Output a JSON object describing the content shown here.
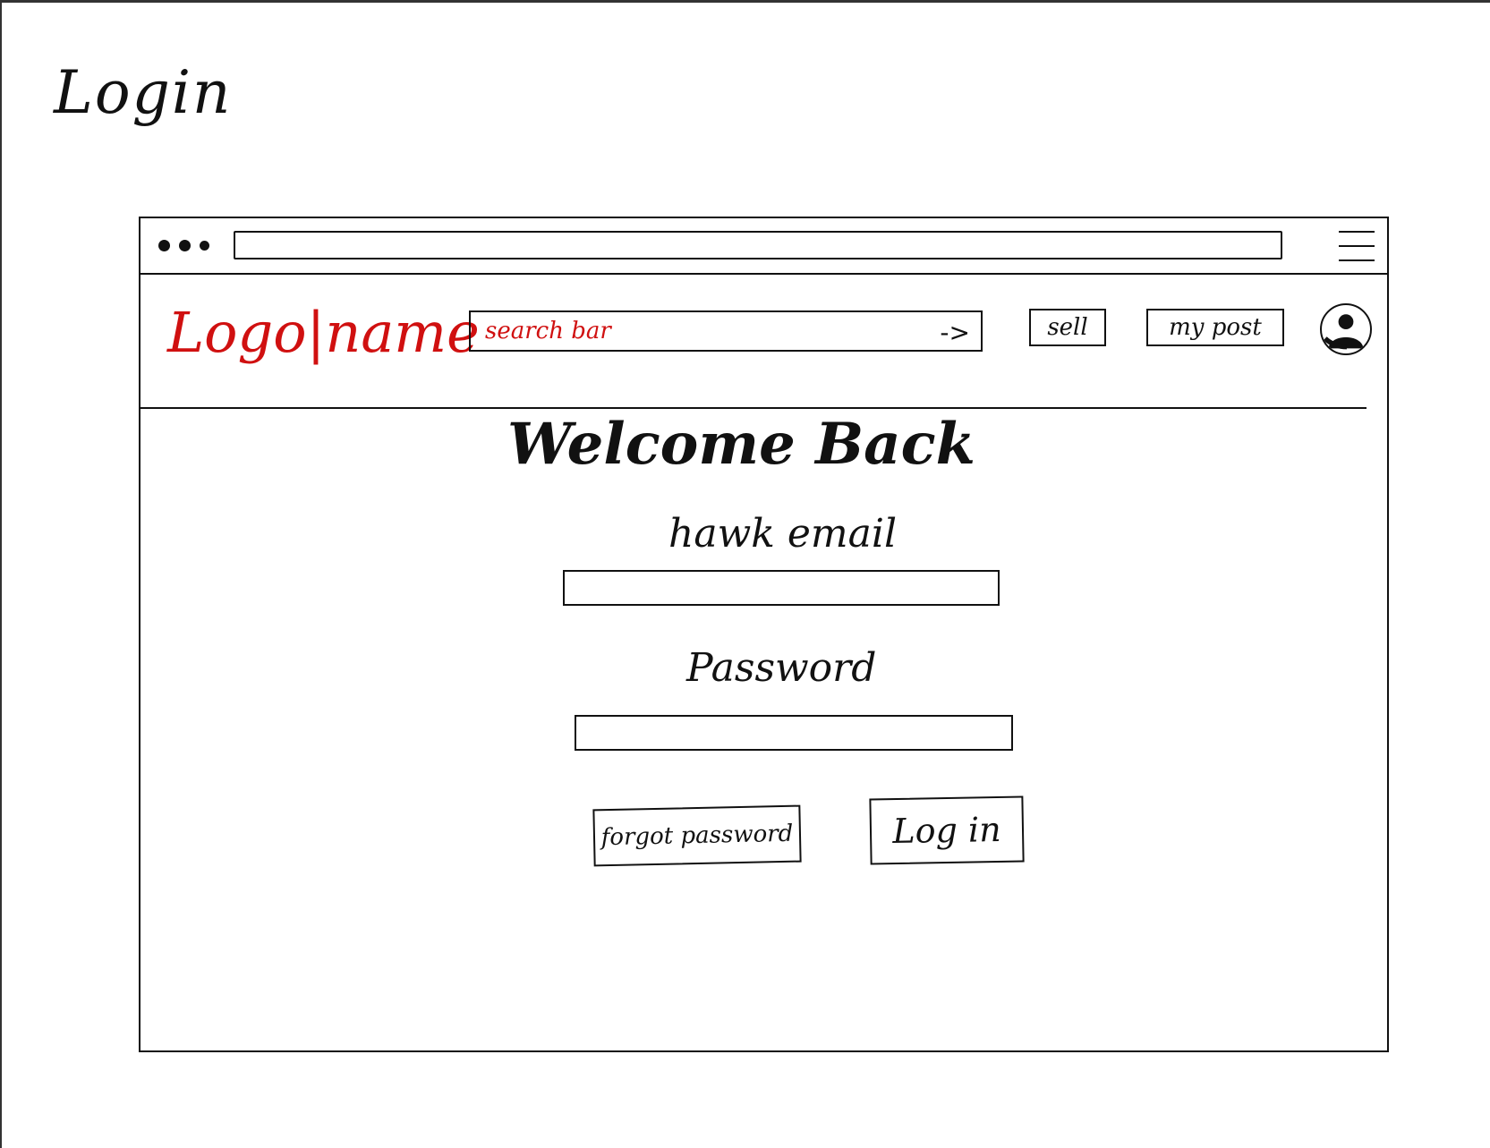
{
  "sketch": {
    "title": "Login"
  },
  "browser": {
    "url_value": ""
  },
  "header": {
    "logo_text": "Logo|name",
    "search_placeholder": "search bar",
    "search_arrow": "->",
    "sell_label": "sell",
    "mypost_label": "my post",
    "avatar_icon": "user-avatar-icon"
  },
  "login": {
    "heading": "Welcome Back",
    "email_label": "hawk email",
    "email_value": "",
    "password_label": "Password",
    "password_value": "",
    "forgot_label": "forgot password",
    "login_label": "Log in"
  },
  "colors": {
    "logo": "#d01010",
    "search_text": "#d01010",
    "ink": "#111111"
  }
}
